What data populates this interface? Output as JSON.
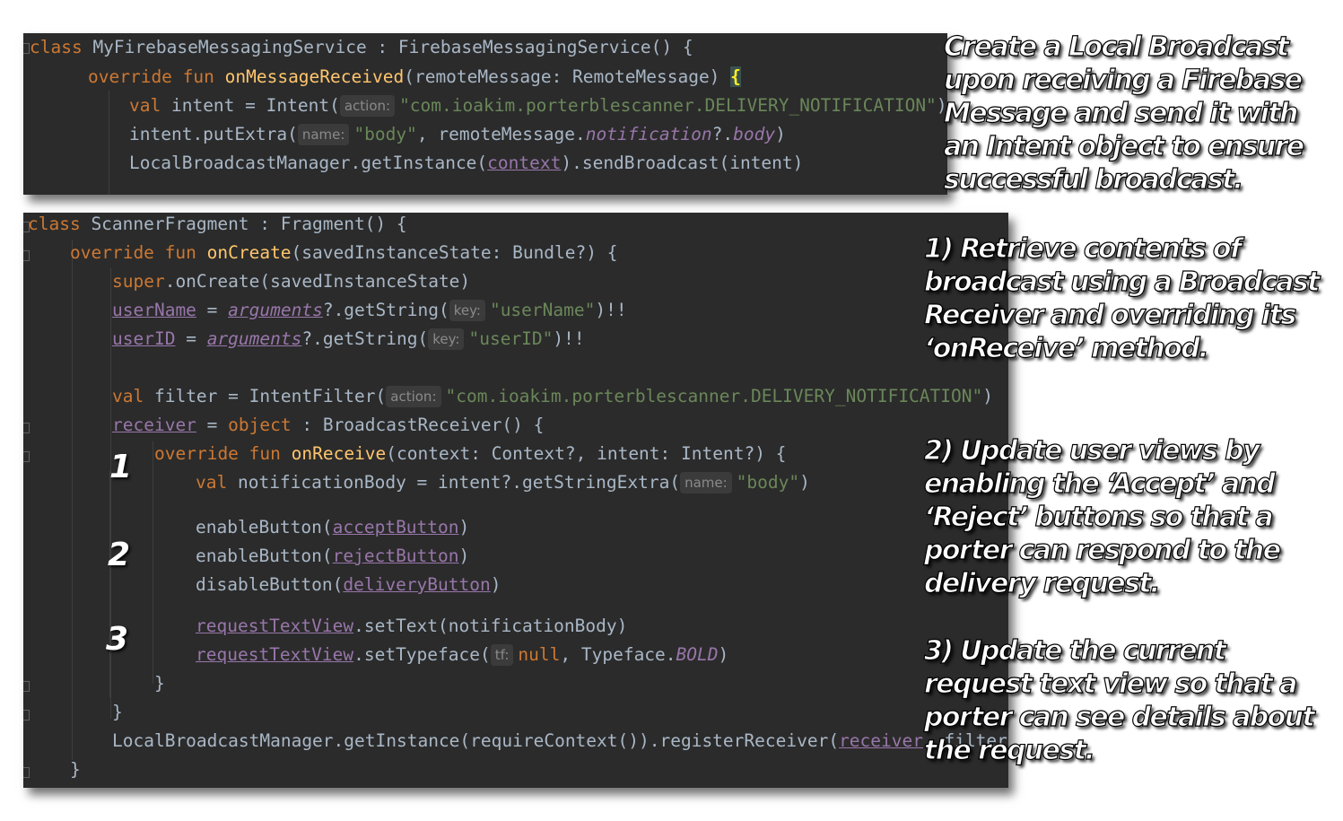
{
  "panel1": {
    "l1": {
      "kw": "class",
      "name": " MyFirebaseMessagingService : FirebaseMessagingService() {"
    },
    "l2": {
      "kw": "override fun ",
      "fn": "onMessageReceived",
      "rest": "(remoteMessage: RemoteMessage) ",
      "brace": "{"
    },
    "l3": {
      "kw": "val",
      "a": " intent = Intent(",
      "hint": "action:",
      "str": "\"com.ioakim.porterblescanner.DELIVERY_NOTIFICATION\"",
      "close": ")"
    },
    "l4": {
      "a": "intent.putExtra(",
      "hint": "name:",
      "str": "\"body\"",
      "b": ", remoteMessage.",
      "p1": "notification",
      "c": "?.",
      "p2": "body",
      "d": ")"
    },
    "l5": {
      "a": "LocalBroadcastManager.getInstance(",
      "link": "context",
      "b": ").sendBroadcast(intent)"
    }
  },
  "panel2": {
    "l1": {
      "kw": "class",
      "name": " ScannerFragment : Fragment() {"
    },
    "l2": {
      "kw": "override fun ",
      "fn": "onCreate",
      "rest": "(savedInstanceState: Bundle?) {"
    },
    "l3": {
      "kw": "super",
      "rest": ".onCreate(savedInstanceState)"
    },
    "l4": {
      "p": "userName",
      "a": " = ",
      "p2": "arguments",
      "b": "?.getString(",
      "hint": "key:",
      "str": "\"userName\"",
      "c": ")!!"
    },
    "l5": {
      "p": "userID",
      "a": " = ",
      "p2": "arguments",
      "b": "?.getString(",
      "hint": "key:",
      "str": "\"userID\"",
      "c": ")!!"
    },
    "l6": {
      "kw": "val",
      "a": " filter = IntentFilter(",
      "hint": "action:",
      "str": "\"com.ioakim.porterblescanner.DELIVERY_NOTIFICATION\"",
      "close": ")"
    },
    "l7": {
      "p": "receiver",
      "a": " = ",
      "kw": "object",
      "b": " : BroadcastReceiver() {"
    },
    "l8": {
      "kw": "override fun ",
      "fn": "onReceive",
      "rest": "(context: Context?, intent: Intent?) {"
    },
    "l9": {
      "kw": "val",
      "a": " notificationBody = intent?.getStringExtra(",
      "hint": "name:",
      "str": "\"body\"",
      "close": ")"
    },
    "l10": {
      "a": "enableButton(",
      "p": "acceptButton",
      "b": ")"
    },
    "l11": {
      "a": "enableButton(",
      "p": "rejectButton",
      "b": ")"
    },
    "l12": {
      "a": "disableButton(",
      "p": "deliveryButton",
      "b": ")"
    },
    "l13": {
      "p": "requestTextView",
      "a": ".setText(notificationBody)"
    },
    "l14": {
      "p": "requestTextView",
      "a": ".setTypeface(",
      "hint": "tf:",
      "kw": "null",
      "b": ", Typeface.",
      "it": "BOLD",
      "c": ")"
    },
    "l15": {
      "a": "}"
    },
    "l16": {
      "a": "}"
    },
    "l17": {
      "a": "LocalBroadcastManager.getInstance(requireContext()).registerReceiver(",
      "p": "receiver",
      "b": ", filter)"
    },
    "l18": {
      "a": "}"
    }
  },
  "steps": {
    "one": "1",
    "two": "2",
    "three": "3"
  },
  "annotations": {
    "note1": "Create a Local Broadcast upon receiving a Firebase Message and send it with an Intent object to ensure successful broadcast.",
    "note2": "1) Retrieve contents of broadcast using a Broadcast Receiver and overriding its ‘onReceive’ method.",
    "note3": "2) Update user views by enabling the ‘Accept’ and ‘Reject’ buttons so that a porter can respond to the delivery request.",
    "note4": "3) Update the current request text view so that a porter can see details about the request."
  },
  "colors": {
    "editor_bg": "#2b2b2b",
    "keyword": "#cc7832",
    "function": "#ffc66d",
    "string": "#6a8759",
    "property": "#9876aa",
    "text": "#a9b7c6"
  }
}
